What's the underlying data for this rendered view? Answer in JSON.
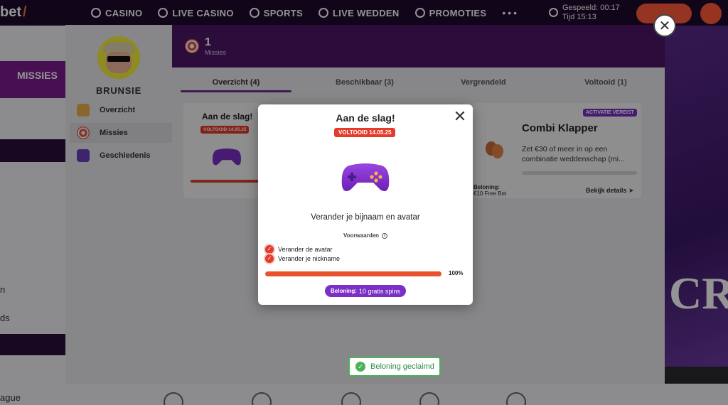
{
  "site": {
    "logo_text": "bet",
    "nav": [
      {
        "label": "CASINO",
        "icon": "casino-icon"
      },
      {
        "label": "LIVE CASINO",
        "icon": "live-casino-icon"
      },
      {
        "label": "SPORTS",
        "icon": "sports-icon"
      },
      {
        "label": "LIVE WEDDEN",
        "icon": "live-betting-icon"
      },
      {
        "label": "PROMOTIES",
        "icon": "promotions-icon"
      }
    ],
    "more": "•••",
    "session_logged": "Gespeeld: 00:17",
    "session_time": "Tijd 15:13",
    "left_band": "MISSIES",
    "left_text_1": "n",
    "left_text_2": "ds",
    "left_text_3": "ague"
  },
  "panel": {
    "username": "BRUNSIE",
    "sidebar": [
      {
        "label": "Overzicht",
        "icon": "overview-icon",
        "active": false
      },
      {
        "label": "Missies",
        "icon": "target-icon",
        "active": true
      },
      {
        "label": "Geschiedenis",
        "icon": "history-icon",
        "active": false
      }
    ],
    "header_count": "1",
    "header_label": "Missies",
    "tabs": [
      "Overzicht (4)",
      "Beschikbaar (3)",
      "Vergrendeld",
      "Voltooid (1)"
    ],
    "left_card": {
      "title": "Aan de slag!",
      "badge": "VOLTOOID 14.05.25"
    },
    "right_card": {
      "badge": "ACTIVATIE VEREIST",
      "title": "Combi Klapper",
      "description": "Zet €30 of meer in op een combinatie weddenschap (mi...",
      "reward_label": "Beloning:",
      "reward": "€10 Free Bet",
      "link": "Bekijk details ➤"
    }
  },
  "modal": {
    "title": "Aan de slag!",
    "badge": "VOLTOOID 14.05.25",
    "mission_text": "Verander je bijnaam en avatar",
    "conditions_label": "Voorwaarden",
    "conditions": [
      "Verander de avatar",
      "Verander je nickname"
    ],
    "progress": 100,
    "progress_label": "100%",
    "reward_label": "Beloning:",
    "reward_value": "10 gratis spins",
    "close_symbol": "✕"
  },
  "toast": {
    "text": "Beloning geclaimd"
  },
  "colors": {
    "accent_purple": "#7b2fc4",
    "header_purple": "#4a1566",
    "done_red": "#e53b2a",
    "progress_orange": "#e8522d",
    "success_green": "#4cb25a"
  }
}
